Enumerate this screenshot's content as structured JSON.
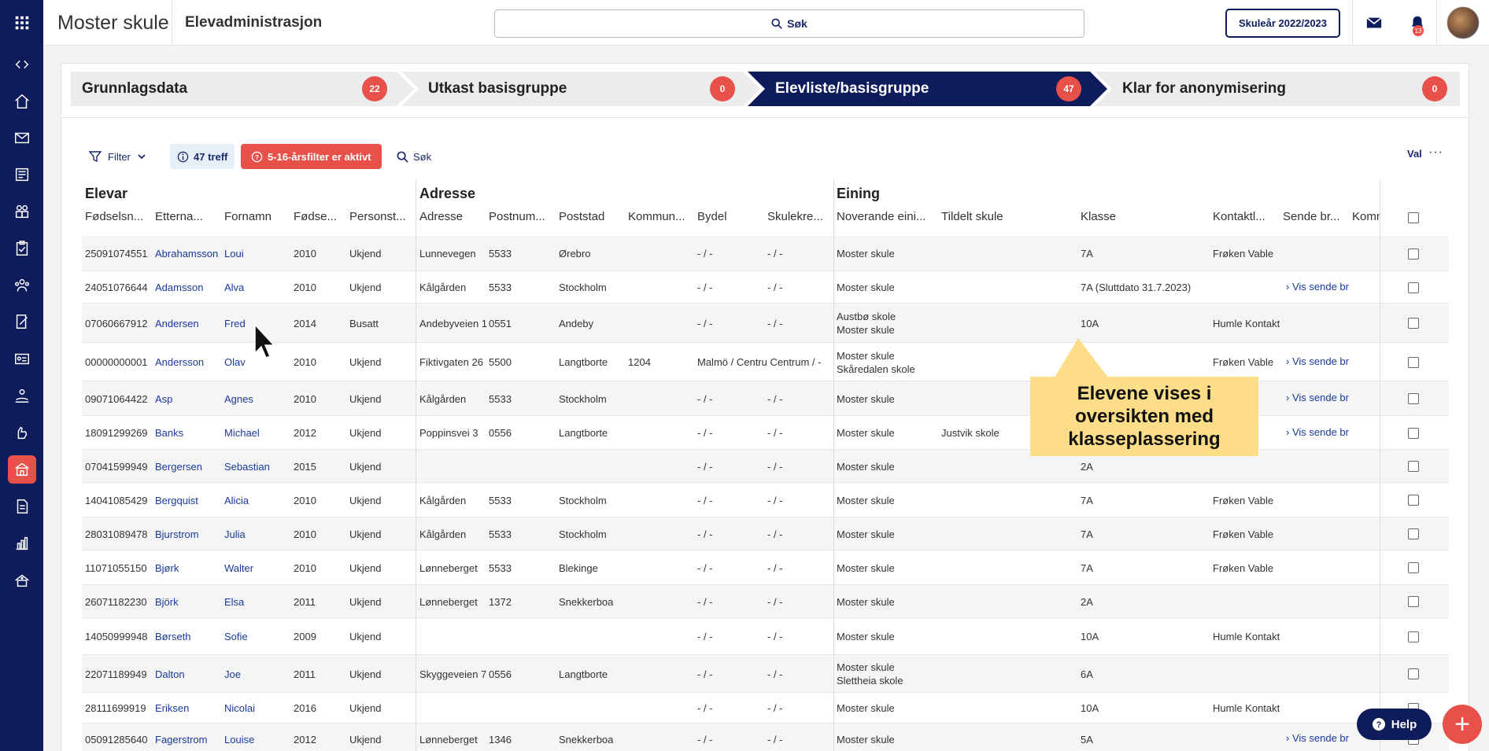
{
  "app": {
    "school": "Moster skule",
    "module": "Elevadministrasjon",
    "search_label": "Søk",
    "school_year": "Skuleår 2022/2023",
    "notifications_count": "13"
  },
  "icons": {
    "rail": [
      "apps-icon",
      "code-toggle-icon",
      "home-icon",
      "mail-icon",
      "news-icon",
      "people-icon",
      "checklist-icon",
      "group-icon",
      "document-edit-icon",
      "id-card-icon",
      "person-hand-icon",
      "hand-icon",
      "school-icon",
      "file-icon",
      "chart-icon",
      "building-icon"
    ]
  },
  "steps": [
    {
      "label": "Grunnlagsdata",
      "count": "22"
    },
    {
      "label": "Utkast basisgruppe",
      "count": "0"
    },
    {
      "label": "Elevliste/basisgruppe",
      "count": "47"
    },
    {
      "label": "Klar for anonymisering",
      "count": "0"
    }
  ],
  "toolbar": {
    "filter": "Filter",
    "hits": "47 treff",
    "warning": "5-16-årsfilter er aktivt",
    "search": "Søk",
    "val": "Val"
  },
  "groups": {
    "elevar": "Elevar",
    "adresse": "Adresse",
    "eining": "Eining"
  },
  "columns": [
    "Fødselsn...",
    "Etterna...",
    "Fornamn",
    "Fødse...",
    "Personst...",
    "Adresse",
    "Postnum...",
    "Poststad",
    "Kommun...",
    "Bydel",
    "Skulekre...",
    "Noverande eini...",
    "Tildelt skule",
    "Klasse",
    "Kontaktl...",
    "Sende br...",
    "Komm"
  ],
  "rows": [
    {
      "fnr": "25091074551",
      "etternavn": "Abrahamsson",
      "fornamn": "Loui",
      "aar": "2010",
      "status": "Ukjend",
      "adresse": "Lunnevegen",
      "postnr": "5533",
      "poststad": "Ørebro",
      "kommune": "",
      "bydel": "- / -",
      "skulekrets": "- / -",
      "eining": [
        "Moster skule"
      ],
      "tildelt": "",
      "klasse": "7A",
      "kontakt": "Frøken Vable",
      "sende": ""
    },
    {
      "fnr": "24051076644",
      "etternavn": "Adamsson",
      "fornamn": "Alva",
      "aar": "2010",
      "status": "Ukjend",
      "adresse": "Kålgården",
      "postnr": "5533",
      "poststad": "Stockholm",
      "kommune": "",
      "bydel": "- / -",
      "skulekrets": "- / -",
      "eining": [
        "Moster skule"
      ],
      "tildelt": "",
      "klasse": "7A (Sluttdato 31.7.2023)",
      "kontakt": "",
      "sende": "Vis sende br"
    },
    {
      "fnr": "07060667912",
      "etternavn": "Andersen",
      "fornamn": "Fred",
      "aar": "2014",
      "status": "Busatt",
      "adresse": "Andebyveien 1",
      "postnr": "0551",
      "poststad": "Andeby",
      "kommune": "",
      "bydel": "- / -",
      "skulekrets": "- / -",
      "eining": [
        "Austbø skole",
        "Moster skule"
      ],
      "tildelt": "",
      "klasse": "10A",
      "kontakt": "Humle Kontakt",
      "sende": ""
    },
    {
      "fnr": "00000000001",
      "etternavn": "Andersson",
      "fornamn": "Olav",
      "aar": "2010",
      "status": "Ukjend",
      "adresse": "Fiktivgaten 26",
      "postnr": "5500",
      "poststad": "Langtborte",
      "kommune": "1204",
      "bydel": "Malmö / Centru Centrum / -",
      "skulekrets": "",
      "eining": [
        "Moster skule",
        "Skåredalen skole"
      ],
      "tildelt": "",
      "klasse": "",
      "kontakt": "Frøken Vable",
      "sende": "Vis sende br"
    },
    {
      "fnr": "09071064422",
      "etternavn": "Asp",
      "fornamn": "Agnes",
      "aar": "2010",
      "status": "Ukjend",
      "adresse": "Kålgården",
      "postnr": "5533",
      "poststad": "Stockholm",
      "kommune": "",
      "bydel": "- / -",
      "skulekrets": "- / -",
      "eining": [
        "Moster skule"
      ],
      "tildelt": "",
      "klasse": "",
      "kontakt": "",
      "sende": "Vis sende br"
    },
    {
      "fnr": "18091299269",
      "etternavn": "Banks",
      "fornamn": "Michael",
      "aar": "2012",
      "status": "Ukjend",
      "adresse": "Poppinsvei 3",
      "postnr": "0556",
      "poststad": "Langtborte",
      "kommune": "",
      "bydel": "- / -",
      "skulekrets": "- / -",
      "eining": [
        "Moster skule"
      ],
      "tildelt": "Justvik skole",
      "klasse": "",
      "kontakt": "",
      "sende": "Vis sende br"
    },
    {
      "fnr": "07041599949",
      "etternavn": "Bergersen",
      "fornamn": "Sebastian",
      "aar": "2015",
      "status": "Ukjend",
      "adresse": "",
      "postnr": "",
      "poststad": "",
      "kommune": "",
      "bydel": "- / -",
      "skulekrets": "- / -",
      "eining": [
        "Moster skule"
      ],
      "tildelt": "",
      "klasse": "2A",
      "kontakt": "",
      "sende": ""
    },
    {
      "fnr": "14041085429",
      "etternavn": "Bergquist",
      "fornamn": "Alicia",
      "aar": "2010",
      "status": "Ukjend",
      "adresse": "Kålgården",
      "postnr": "5533",
      "poststad": "Stockholm",
      "kommune": "",
      "bydel": "- / -",
      "skulekrets": "- / -",
      "eining": [
        "Moster skule"
      ],
      "tildelt": "",
      "klasse": "7A",
      "kontakt": "Frøken Vable",
      "sende": ""
    },
    {
      "fnr": "28031089478",
      "etternavn": "Bjurstrom",
      "fornamn": "Julia",
      "aar": "2010",
      "status": "Ukjend",
      "adresse": "Kålgården",
      "postnr": "5533",
      "poststad": "Stockholm",
      "kommune": "",
      "bydel": "- / -",
      "skulekrets": "- / -",
      "eining": [
        "Moster skule"
      ],
      "tildelt": "",
      "klasse": "7A",
      "kontakt": "Frøken Vable",
      "sende": ""
    },
    {
      "fnr": "11071055150",
      "etternavn": "Bjørk",
      "fornamn": "Walter",
      "aar": "2010",
      "status": "Ukjend",
      "adresse": "Lønneberget",
      "postnr": "5533",
      "poststad": "Blekinge",
      "kommune": "",
      "bydel": "- / -",
      "skulekrets": "- / -",
      "eining": [
        "Moster skule"
      ],
      "tildelt": "",
      "klasse": "7A",
      "kontakt": "Frøken Vable",
      "sende": ""
    },
    {
      "fnr": "26071182230",
      "etternavn": "Björk",
      "fornamn": "Elsa",
      "aar": "2011",
      "status": "Ukjend",
      "adresse": "Lønneberget",
      "postnr": "1372",
      "poststad": "Snekkerboa",
      "kommune": "",
      "bydel": "- / -",
      "skulekrets": "- / -",
      "eining": [
        "Moster skule"
      ],
      "tildelt": "",
      "klasse": "2A",
      "kontakt": "",
      "sende": ""
    },
    {
      "fnr": "14050999948",
      "etternavn": "Børseth",
      "fornamn": "Sofie",
      "aar": "2009",
      "status": "Ukjend",
      "adresse": "",
      "postnr": "",
      "poststad": "",
      "kommune": "",
      "bydel": "- / -",
      "skulekrets": "- / -",
      "eining": [
        "Moster skule"
      ],
      "tildelt": "",
      "klasse": "10A",
      "kontakt": "Humle Kontakt",
      "sende": ""
    },
    {
      "fnr": "22071189949",
      "etternavn": "Dalton",
      "fornamn": "Joe",
      "aar": "2011",
      "status": "Ukjend",
      "adresse": "Skyggeveien 7",
      "postnr": "0556",
      "poststad": "Langtborte",
      "kommune": "",
      "bydel": "- / -",
      "skulekrets": "- / -",
      "eining": [
        "Moster skule",
        "Slettheia skole"
      ],
      "tildelt": "",
      "klasse": "6A",
      "kontakt": "",
      "sende": ""
    },
    {
      "fnr": "28111699919",
      "etternavn": "Eriksen",
      "fornamn": "Nicolai",
      "aar": "2016",
      "status": "Ukjend",
      "adresse": "",
      "postnr": "",
      "poststad": "",
      "kommune": "",
      "bydel": "- / -",
      "skulekrets": "- / -",
      "eining": [
        "Moster skule"
      ],
      "tildelt": "",
      "klasse": "10A",
      "kontakt": "Humle Kontakt",
      "sende": ""
    },
    {
      "fnr": "05091285640",
      "etternavn": "Fagerstrom",
      "fornamn": "Louise",
      "aar": "2012",
      "status": "Ukjend",
      "adresse": "Lønneberget",
      "postnr": "1346",
      "poststad": "Snekkerboa",
      "kommune": "",
      "bydel": "- / -",
      "skulekrets": "- / -",
      "eining": [
        "Moster skule"
      ],
      "tildelt": "",
      "klasse": "5A",
      "kontakt": "",
      "sende": "Vis sende br"
    }
  ],
  "callout": {
    "line1": "Elevene vises i",
    "line2": "oversikten med",
    "line3": "klasseplassering"
  },
  "help": {
    "label": "Help"
  },
  "fab": {
    "label": "+"
  },
  "colors": {
    "rail": "#0e1c5c",
    "accent": "#e8504a",
    "callout": "#fddd87",
    "active_step": "#0e1c5c"
  }
}
